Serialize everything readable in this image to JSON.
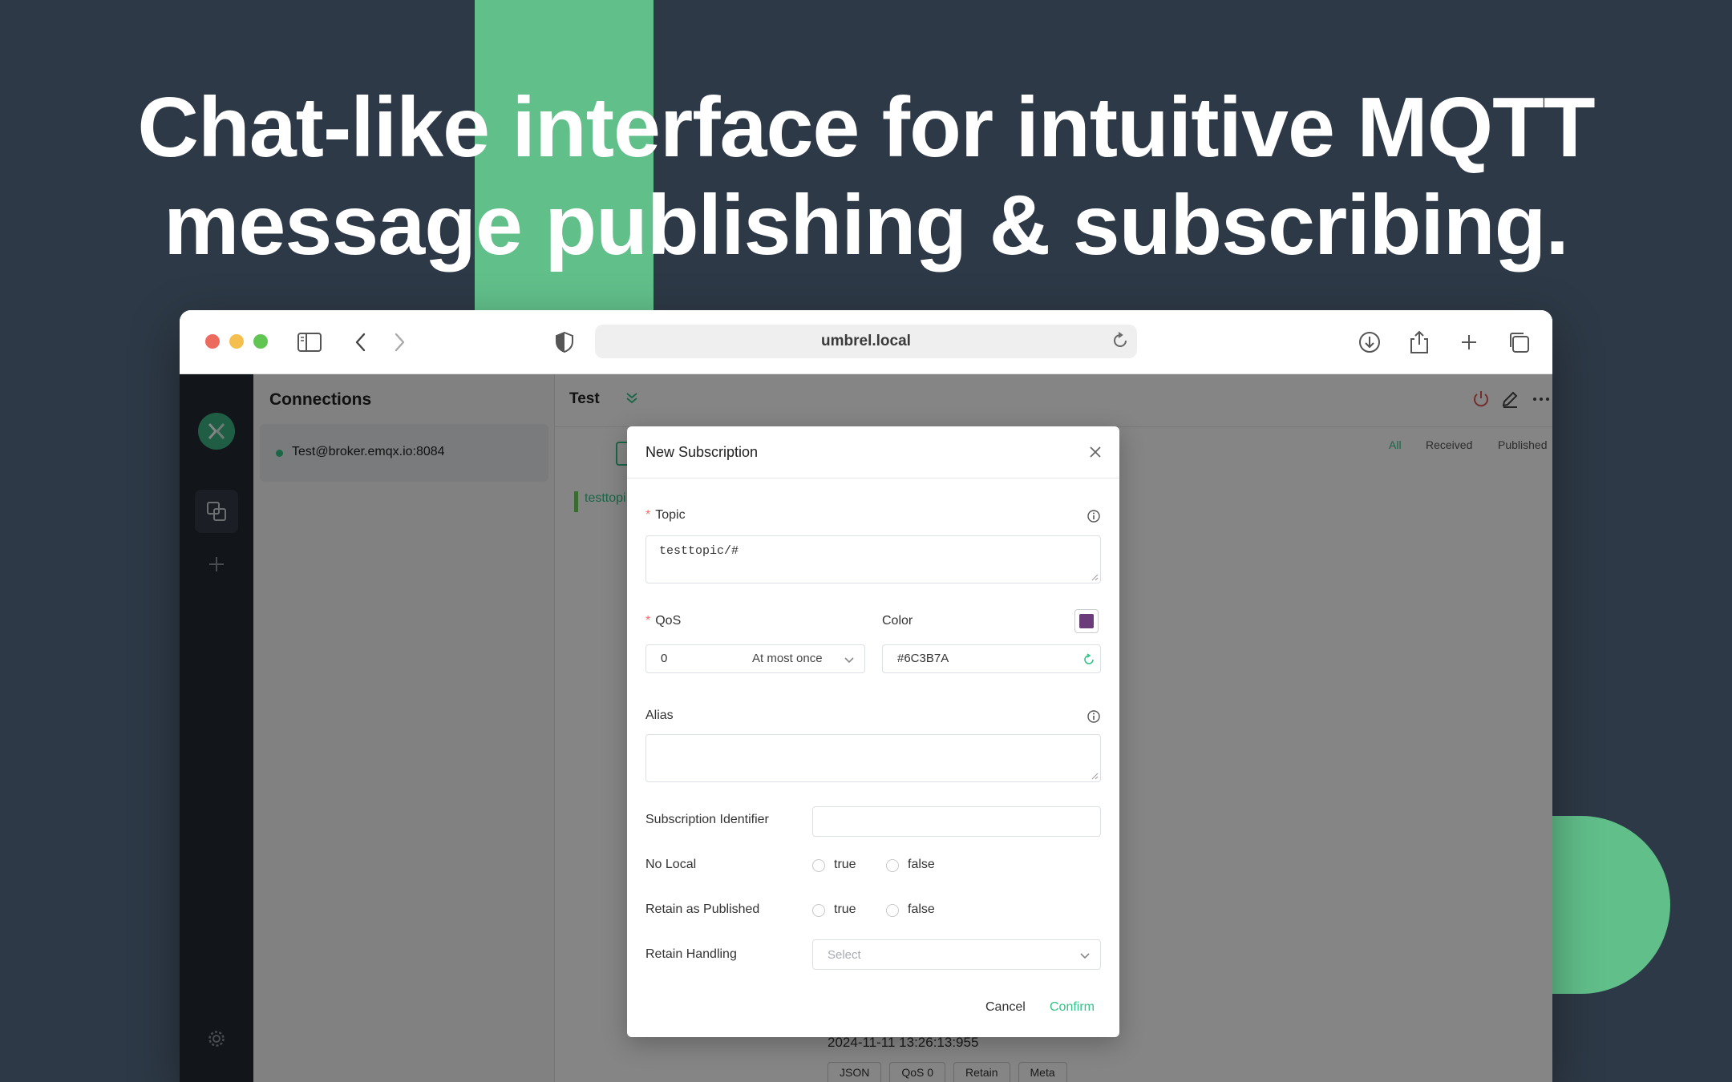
{
  "headline": {
    "line1": "Chat-like interface for intuitive MQTT",
    "line2": "message publishing & subscribing."
  },
  "colors": {
    "accent": "#34c388",
    "brand_green": "#61bf8a",
    "background": "#2d3946",
    "subscription_color": "#6C3B7A"
  },
  "browser": {
    "url": "umbrel.local",
    "icons": [
      "sidebar-icon",
      "back-icon",
      "forward-icon",
      "shield-icon",
      "reload-icon",
      "download-icon",
      "share-icon",
      "new-tab-icon",
      "tabs-overview-icon"
    ]
  },
  "app": {
    "connections_title": "Connections",
    "connection_name": "Test@broker.emqx.io:8084",
    "main_title": "Test",
    "filters": [
      "All",
      "Received",
      "Published"
    ],
    "subscription_chip": "testtopic/#",
    "timestamp": "2024-11-11 13:26:13:955",
    "bottom_tags": [
      "JSON",
      "QoS 0",
      "Retain",
      "Meta"
    ]
  },
  "dialog": {
    "title": "New Subscription",
    "topic_label": "Topic",
    "topic_value": "testtopic/#",
    "qos_label": "QoS",
    "qos_value": "0",
    "qos_desc": "At most once",
    "color_label": "Color",
    "color_value": "#6C3B7A",
    "alias_label": "Alias",
    "alias_value": "",
    "sub_id_label": "Subscription Identifier",
    "sub_id_value": "",
    "no_local_label": "No Local",
    "retain_as_published_label": "Retain as Published",
    "retain_handling_label": "Retain Handling",
    "retain_handling_placeholder": "Select",
    "option_true": "true",
    "option_false": "false",
    "cancel_label": "Cancel",
    "confirm_label": "Confirm"
  }
}
